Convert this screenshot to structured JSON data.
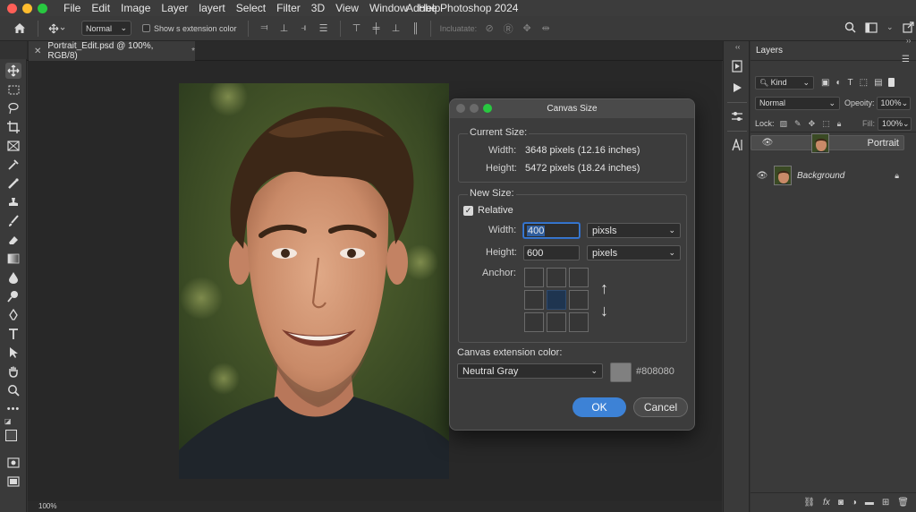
{
  "menubar": {
    "app_menu": [
      "File",
      "Edit",
      "Image",
      "Layer",
      "layert",
      "Select",
      "Filter",
      "3D",
      "View",
      "Window",
      "Help"
    ],
    "title": "Adobe Photoshop 2024"
  },
  "options": {
    "mode": "Normal",
    "show_ext_label": "Show s extension color",
    "incluatate_label": "Incluatate:"
  },
  "document": {
    "tab_title": "Portrait_Edit.psd @ 100%, RGB/8)",
    "tab_modified": "*",
    "zoom_status": "100%"
  },
  "layers_panel": {
    "title": "Layers",
    "filter_kind": "Kind",
    "blend_mode": "Normal",
    "opacity_label": "Opeoity:",
    "opacity_value": "100%",
    "lock_label": "Lock:",
    "fill_label": "Fill:",
    "fill_value": "100%",
    "layers": [
      {
        "name": "Portrait",
        "selected": true
      },
      {
        "name": "Background",
        "selected": false,
        "locked": true
      }
    ]
  },
  "dialog": {
    "title": "Canvas Size",
    "current_size_label": "Current Size:",
    "current_width_label": "Width:",
    "current_width_value": "3648 pixels (12.16 inches)",
    "current_height_label": "Height:",
    "current_height_value": "5472 pixels (18.24 inches)",
    "new_size_label": "New Size:",
    "relative_label": "Relative",
    "relative_checked": true,
    "width_label": "Width:",
    "width_value": "400",
    "width_unit": "pixsls",
    "height_label": "Height:",
    "height_value": "600",
    "height_unit": "pixels",
    "anchor_label": "Anchor:",
    "extension_label": "Canvas extension color:",
    "extension_option": "Neutral Gray",
    "extension_hex": "#808080",
    "ok_label": "OK",
    "cancel_label": "Cancel"
  },
  "colors": {
    "accent": "#3d82d6",
    "swatch": "#808080",
    "traffic_red": "#fe5f57",
    "traffic_yellow": "#febc2e",
    "traffic_green": "#28c840"
  }
}
